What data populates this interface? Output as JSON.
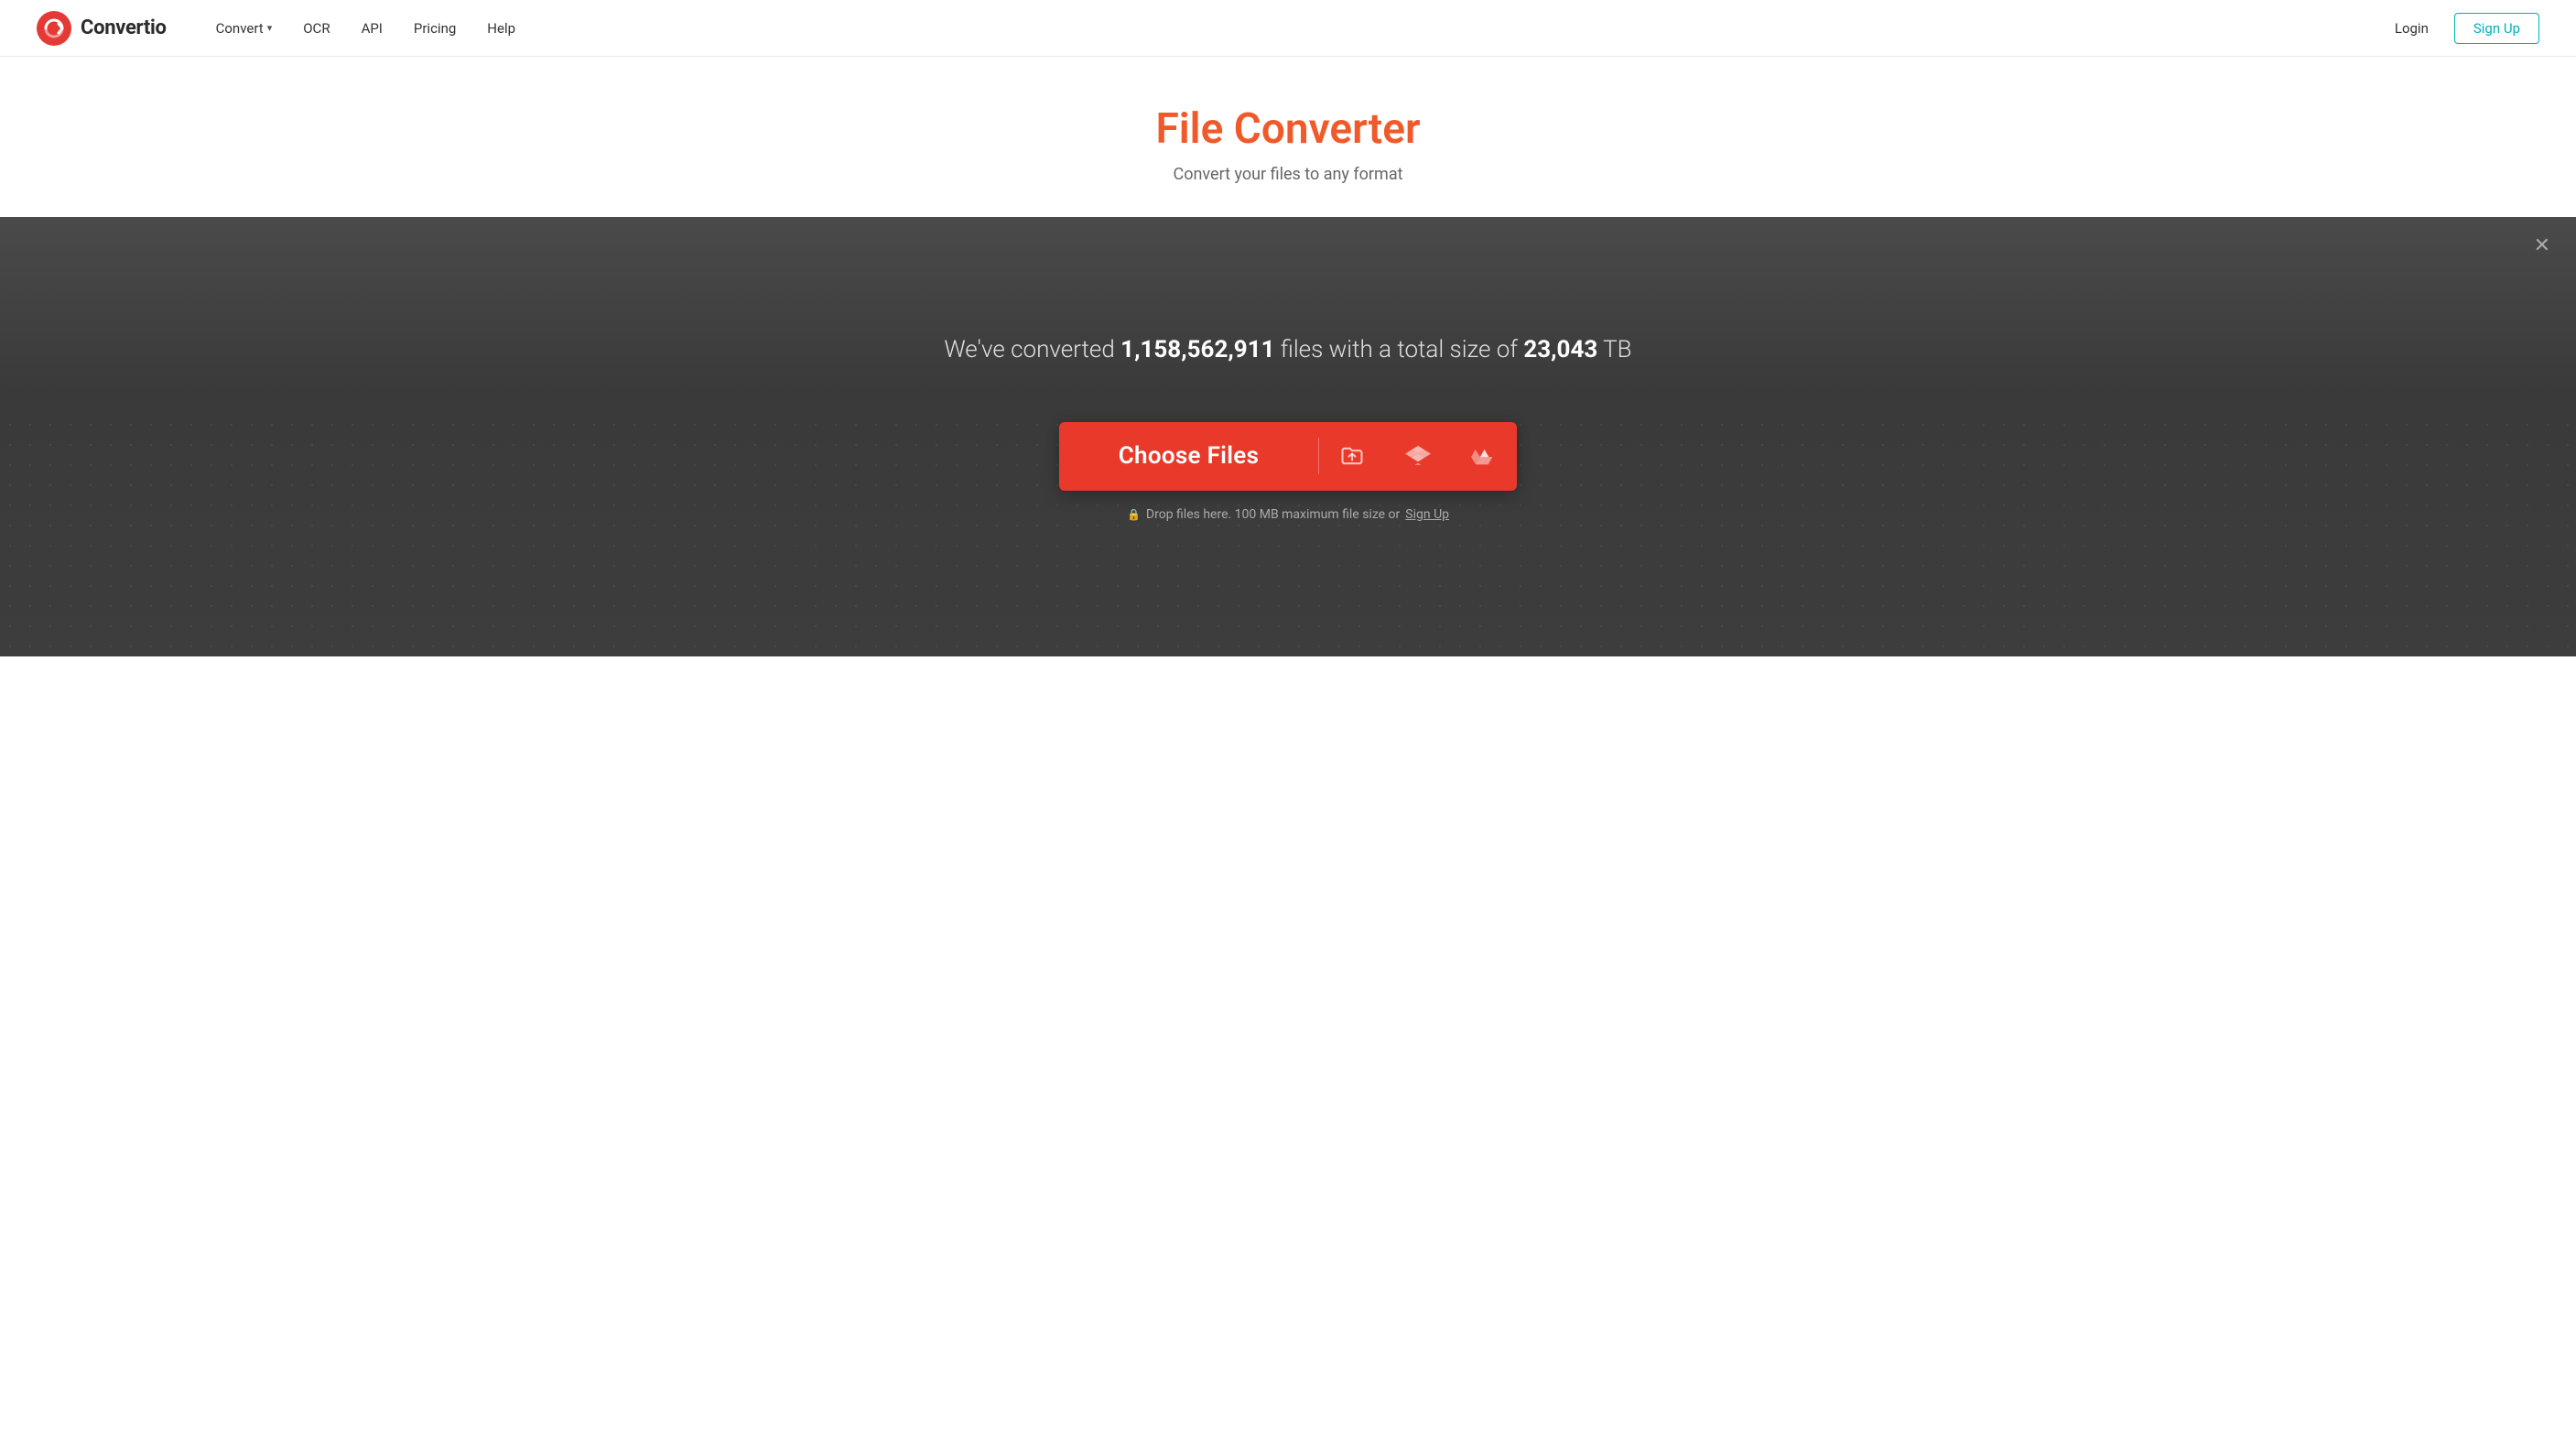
{
  "header": {
    "logo_text": "Convertio",
    "nav": [
      {
        "label": "Convert",
        "has_arrow": true,
        "id": "convert"
      },
      {
        "label": "OCR",
        "has_arrow": false,
        "id": "ocr"
      },
      {
        "label": "API",
        "has_arrow": false,
        "id": "api"
      },
      {
        "label": "Pricing",
        "has_arrow": false,
        "id": "pricing"
      },
      {
        "label": "Help",
        "has_arrow": false,
        "id": "help"
      }
    ],
    "login_label": "Login",
    "signup_label": "Sign Up"
  },
  "hero": {
    "title": "File Converter",
    "subtitle": "Convert your files to any format"
  },
  "converter": {
    "stats_prefix": "We've converted ",
    "stats_files": "1,158,562,911",
    "stats_middle": " files with a total size of ",
    "stats_size": "23,043",
    "stats_suffix": " TB",
    "choose_files_label": "Choose Files",
    "drop_info_prefix": "Drop files here. 100 MB maximum file size or ",
    "drop_info_signup": "Sign Up",
    "icons": {
      "folder": "folder-upload-icon",
      "dropbox": "dropbox-icon",
      "drive": "google-drive-icon"
    }
  }
}
